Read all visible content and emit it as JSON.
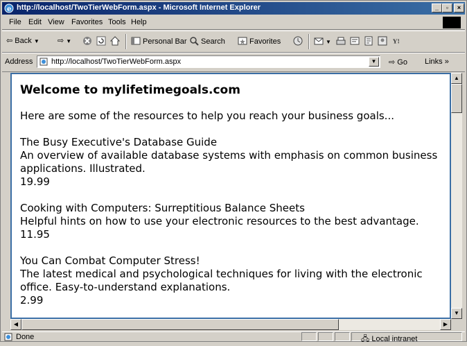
{
  "window": {
    "title": "http://localhost/TwoTierWebForm.aspx - Microsoft Internet Explorer",
    "controls": [
      "_",
      "▫",
      "×"
    ]
  },
  "menu": [
    "File",
    "Edit",
    "View",
    "Favorites",
    "Tools",
    "Help"
  ],
  "toolbar": {
    "back": "Back",
    "personal_bar": "Personal Bar",
    "search": "Search",
    "favorites": "Favorites"
  },
  "address": {
    "label": "Address",
    "url": "http://localhost/TwoTierWebForm.aspx",
    "go": "Go",
    "links": "Links »"
  },
  "page": {
    "heading": "Welcome to mylifetimegoals.com",
    "intro": "Here are some of the resources to help you reach your business goals...",
    "books": [
      {
        "title": "The Busy Executive's Database Guide",
        "description": "An overview of available database systems with emphasis on common business applications. Illustrated.",
        "price": "19.99"
      },
      {
        "title": "Cooking with Computers: Surreptitious Balance Sheets",
        "description": "Helpful hints on how to use your electronic resources to the best advantage.",
        "price": "11.95"
      },
      {
        "title": "You Can Combat Computer Stress!",
        "description": "The latest medical and psychological techniques for living with the electronic office. Easy-to-understand explanations.",
        "price": "2.99"
      }
    ]
  },
  "status": {
    "text": "Done",
    "zone": "Local intranet"
  },
  "colors": {
    "titlebar_start": "#0a246a",
    "titlebar_end": "#3a6ea5",
    "viewport_border": "#3a6ea5"
  }
}
